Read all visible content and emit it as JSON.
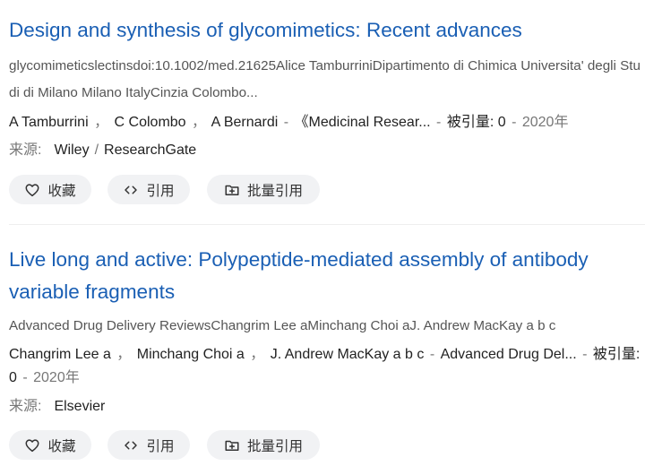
{
  "results": [
    {
      "title_left": "Design and synthesis of glycomimetics",
      "title_sep": ":",
      "title_right": " Recent advances",
      "abstract": "glycomimeticslectinsdoi:10.1002/med.21625Alice TamburriniDipartimento di Chimica Universita' degli Studi di Milano Milano ItalyCinzia Colombo...",
      "authors": [
        "A Tamburrini",
        "C Colombo",
        "A Bernardi"
      ],
      "journal": "《Medicinal Resear...",
      "cited_label": "被引量:",
      "cited_count": "0",
      "year": "2020年",
      "source_label": "来源:",
      "sources": [
        "Wiley",
        "ResearchGate"
      ],
      "actions": {
        "favorite": "收藏",
        "cite": "引用",
        "batch_cite": "批量引用"
      }
    },
    {
      "title_left": "Live long and active",
      "title_sep": ":",
      "title_right": " Polypeptide-mediated assembly of antibody variable fragments",
      "abstract": "Advanced Drug Delivery ReviewsChangrim Lee aMinchang Choi aJ. Andrew MacKay a b c",
      "authors": [
        "Changrim Lee a",
        "Minchang Choi a",
        "J. Andrew MacKay a b c"
      ],
      "journal": "Advanced Drug Del...",
      "cited_label": "被引量:",
      "cited_count": "0",
      "year": "2020年",
      "source_label": "来源:",
      "sources": [
        "Elsevier"
      ],
      "actions": {
        "favorite": "收藏",
        "cite": "引用",
        "batch_cite": "批量引用"
      }
    }
  ],
  "icons": {
    "favorite": "heart-icon",
    "cite": "code-brackets-icon",
    "batch_cite": "folder-plus-icon"
  },
  "colors": {
    "title_link": "#1a5fb4",
    "button_bg": "#f1f2f4",
    "muted_text": "#777777"
  }
}
